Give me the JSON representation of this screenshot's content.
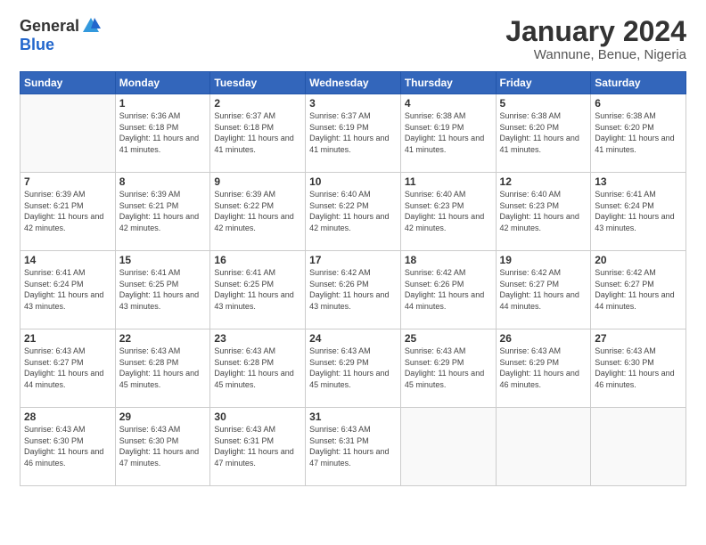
{
  "logo": {
    "general": "General",
    "blue": "Blue"
  },
  "title": "January 2024",
  "location": "Wannune, Benue, Nigeria",
  "days_of_week": [
    "Sunday",
    "Monday",
    "Tuesday",
    "Wednesday",
    "Thursday",
    "Friday",
    "Saturday"
  ],
  "weeks": [
    [
      {
        "day": "",
        "sunrise": "",
        "sunset": "",
        "daylight": ""
      },
      {
        "day": "1",
        "sunrise": "Sunrise: 6:36 AM",
        "sunset": "Sunset: 6:18 PM",
        "daylight": "Daylight: 11 hours and 41 minutes."
      },
      {
        "day": "2",
        "sunrise": "Sunrise: 6:37 AM",
        "sunset": "Sunset: 6:18 PM",
        "daylight": "Daylight: 11 hours and 41 minutes."
      },
      {
        "day": "3",
        "sunrise": "Sunrise: 6:37 AM",
        "sunset": "Sunset: 6:19 PM",
        "daylight": "Daylight: 11 hours and 41 minutes."
      },
      {
        "day": "4",
        "sunrise": "Sunrise: 6:38 AM",
        "sunset": "Sunset: 6:19 PM",
        "daylight": "Daylight: 11 hours and 41 minutes."
      },
      {
        "day": "5",
        "sunrise": "Sunrise: 6:38 AM",
        "sunset": "Sunset: 6:20 PM",
        "daylight": "Daylight: 11 hours and 41 minutes."
      },
      {
        "day": "6",
        "sunrise": "Sunrise: 6:38 AM",
        "sunset": "Sunset: 6:20 PM",
        "daylight": "Daylight: 11 hours and 41 minutes."
      }
    ],
    [
      {
        "day": "7",
        "sunrise": "Sunrise: 6:39 AM",
        "sunset": "Sunset: 6:21 PM",
        "daylight": "Daylight: 11 hours and 42 minutes."
      },
      {
        "day": "8",
        "sunrise": "Sunrise: 6:39 AM",
        "sunset": "Sunset: 6:21 PM",
        "daylight": "Daylight: 11 hours and 42 minutes."
      },
      {
        "day": "9",
        "sunrise": "Sunrise: 6:39 AM",
        "sunset": "Sunset: 6:22 PM",
        "daylight": "Daylight: 11 hours and 42 minutes."
      },
      {
        "day": "10",
        "sunrise": "Sunrise: 6:40 AM",
        "sunset": "Sunset: 6:22 PM",
        "daylight": "Daylight: 11 hours and 42 minutes."
      },
      {
        "day": "11",
        "sunrise": "Sunrise: 6:40 AM",
        "sunset": "Sunset: 6:23 PM",
        "daylight": "Daylight: 11 hours and 42 minutes."
      },
      {
        "day": "12",
        "sunrise": "Sunrise: 6:40 AM",
        "sunset": "Sunset: 6:23 PM",
        "daylight": "Daylight: 11 hours and 42 minutes."
      },
      {
        "day": "13",
        "sunrise": "Sunrise: 6:41 AM",
        "sunset": "Sunset: 6:24 PM",
        "daylight": "Daylight: 11 hours and 43 minutes."
      }
    ],
    [
      {
        "day": "14",
        "sunrise": "Sunrise: 6:41 AM",
        "sunset": "Sunset: 6:24 PM",
        "daylight": "Daylight: 11 hours and 43 minutes."
      },
      {
        "day": "15",
        "sunrise": "Sunrise: 6:41 AM",
        "sunset": "Sunset: 6:25 PM",
        "daylight": "Daylight: 11 hours and 43 minutes."
      },
      {
        "day": "16",
        "sunrise": "Sunrise: 6:41 AM",
        "sunset": "Sunset: 6:25 PM",
        "daylight": "Daylight: 11 hours and 43 minutes."
      },
      {
        "day": "17",
        "sunrise": "Sunrise: 6:42 AM",
        "sunset": "Sunset: 6:26 PM",
        "daylight": "Daylight: 11 hours and 43 minutes."
      },
      {
        "day": "18",
        "sunrise": "Sunrise: 6:42 AM",
        "sunset": "Sunset: 6:26 PM",
        "daylight": "Daylight: 11 hours and 44 minutes."
      },
      {
        "day": "19",
        "sunrise": "Sunrise: 6:42 AM",
        "sunset": "Sunset: 6:27 PM",
        "daylight": "Daylight: 11 hours and 44 minutes."
      },
      {
        "day": "20",
        "sunrise": "Sunrise: 6:42 AM",
        "sunset": "Sunset: 6:27 PM",
        "daylight": "Daylight: 11 hours and 44 minutes."
      }
    ],
    [
      {
        "day": "21",
        "sunrise": "Sunrise: 6:43 AM",
        "sunset": "Sunset: 6:27 PM",
        "daylight": "Daylight: 11 hours and 44 minutes."
      },
      {
        "day": "22",
        "sunrise": "Sunrise: 6:43 AM",
        "sunset": "Sunset: 6:28 PM",
        "daylight": "Daylight: 11 hours and 45 minutes."
      },
      {
        "day": "23",
        "sunrise": "Sunrise: 6:43 AM",
        "sunset": "Sunset: 6:28 PM",
        "daylight": "Daylight: 11 hours and 45 minutes."
      },
      {
        "day": "24",
        "sunrise": "Sunrise: 6:43 AM",
        "sunset": "Sunset: 6:29 PM",
        "daylight": "Daylight: 11 hours and 45 minutes."
      },
      {
        "day": "25",
        "sunrise": "Sunrise: 6:43 AM",
        "sunset": "Sunset: 6:29 PM",
        "daylight": "Daylight: 11 hours and 45 minutes."
      },
      {
        "day": "26",
        "sunrise": "Sunrise: 6:43 AM",
        "sunset": "Sunset: 6:29 PM",
        "daylight": "Daylight: 11 hours and 46 minutes."
      },
      {
        "day": "27",
        "sunrise": "Sunrise: 6:43 AM",
        "sunset": "Sunset: 6:30 PM",
        "daylight": "Daylight: 11 hours and 46 minutes."
      }
    ],
    [
      {
        "day": "28",
        "sunrise": "Sunrise: 6:43 AM",
        "sunset": "Sunset: 6:30 PM",
        "daylight": "Daylight: 11 hours and 46 minutes."
      },
      {
        "day": "29",
        "sunrise": "Sunrise: 6:43 AM",
        "sunset": "Sunset: 6:30 PM",
        "daylight": "Daylight: 11 hours and 47 minutes."
      },
      {
        "day": "30",
        "sunrise": "Sunrise: 6:43 AM",
        "sunset": "Sunset: 6:31 PM",
        "daylight": "Daylight: 11 hours and 47 minutes."
      },
      {
        "day": "31",
        "sunrise": "Sunrise: 6:43 AM",
        "sunset": "Sunset: 6:31 PM",
        "daylight": "Daylight: 11 hours and 47 minutes."
      },
      {
        "day": "",
        "sunrise": "",
        "sunset": "",
        "daylight": ""
      },
      {
        "day": "",
        "sunrise": "",
        "sunset": "",
        "daylight": ""
      },
      {
        "day": "",
        "sunrise": "",
        "sunset": "",
        "daylight": ""
      }
    ]
  ]
}
